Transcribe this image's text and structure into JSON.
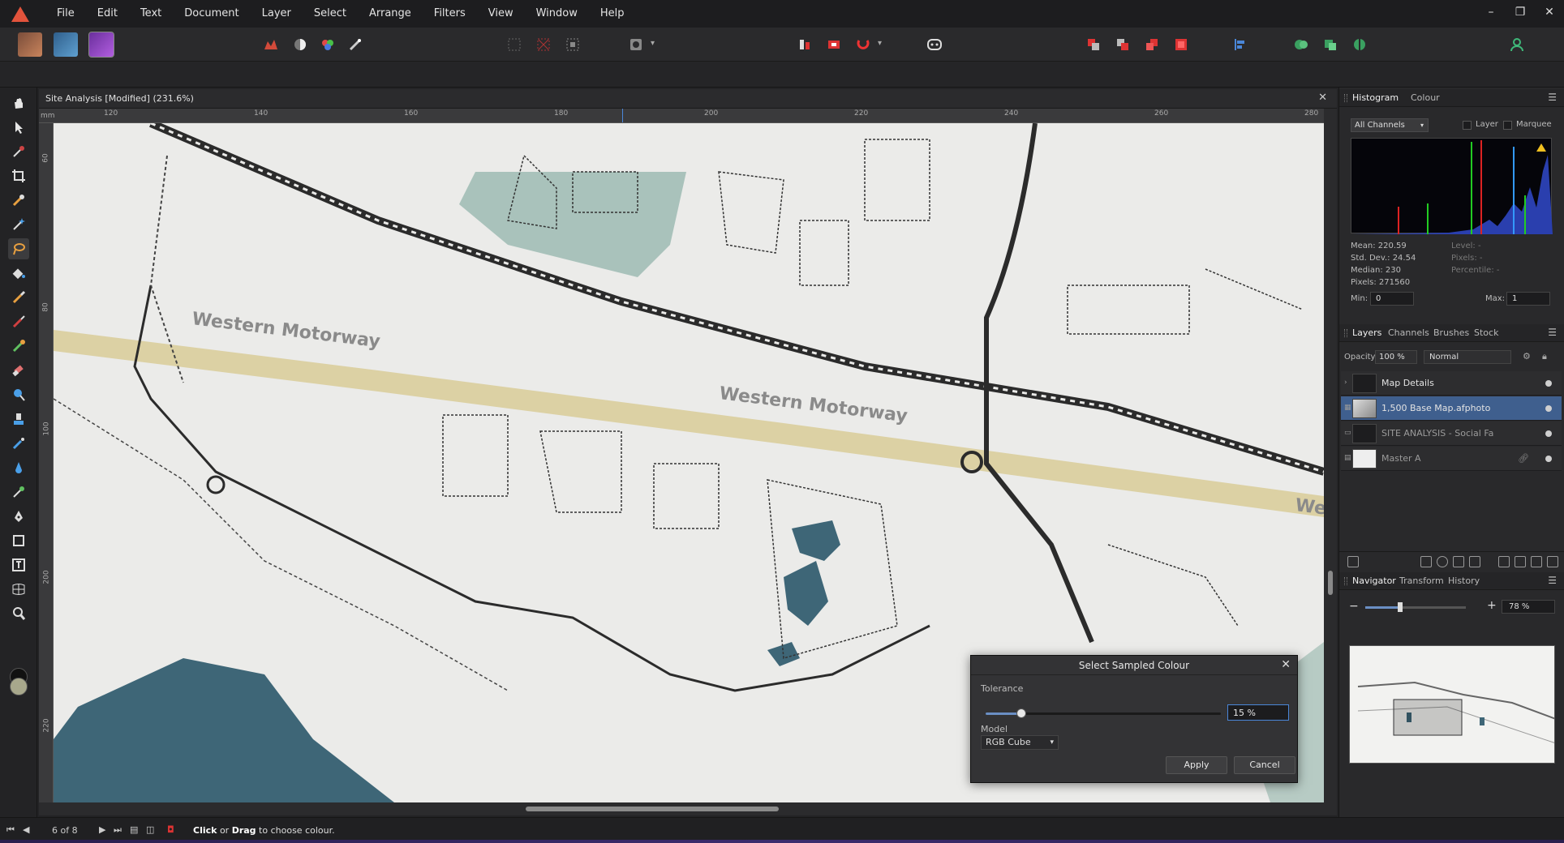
{
  "menubar": {
    "items": [
      "File",
      "Edit",
      "Text",
      "Document",
      "Layer",
      "Select",
      "Arrange",
      "Filters",
      "View",
      "Window",
      "Help"
    ],
    "window_controls": [
      "–",
      "❐",
      "✕"
    ]
  },
  "document": {
    "title": "Site Analysis [Modified] (231.6%)",
    "ruler_unit": "mm",
    "ruler_top_labels": [
      "120",
      "140",
      "160",
      "180",
      "200",
      "220",
      "240",
      "260",
      "280"
    ],
    "ruler_left_labels": [
      "60",
      "80",
      "100",
      "200",
      "220"
    ]
  },
  "map": {
    "road_label_1": "Western Motorway",
    "road_label_2": "Western Motorway",
    "road_label_3": "We",
    "colors": {
      "paper": "#ebebe9",
      "water": "#3e6677",
      "park": "#a9c2bb",
      "motorway": "#dcd1a4",
      "road": "#2b2b2b"
    }
  },
  "dialog": {
    "title": "Select Sampled Colour",
    "tolerance_label": "Tolerance",
    "tolerance_value": "15 %",
    "tolerance_fraction": 0.15,
    "model_label": "Model",
    "model_value": "RGB Cube",
    "apply_label": "Apply",
    "cancel_label": "Cancel"
  },
  "histogram_panel": {
    "tabs": [
      "Histogram",
      "Colour"
    ],
    "channel": "All Channels",
    "layer_label": "Layer",
    "marquee_label": "Marquee",
    "stats": {
      "mean": "Mean: 220.59",
      "std_dev": "Std. Dev.: 24.54",
      "median": "Median: 230",
      "pixels": "Pixels: 271560",
      "level": "Level: -",
      "pixels_sel": "Pixels: -",
      "percentile": "Percentile: -"
    },
    "min_label": "Min:",
    "min_value": "0",
    "max_label": "Max:",
    "max_value": "1"
  },
  "layers_panel": {
    "tabs": [
      "Layers",
      "Channels",
      "Brushes",
      "Stock"
    ],
    "opacity_label": "Opacity:",
    "opacity_value": "100 %",
    "blend_mode": "Normal",
    "layers": [
      {
        "name": "Map Details",
        "selected": false
      },
      {
        "name": "1,500 Base Map.afphoto",
        "selected": true
      },
      {
        "name": "SITE ANALYSIS - Social Fa",
        "selected": false
      },
      {
        "name": "Master A",
        "selected": false
      }
    ]
  },
  "navigator_panel": {
    "tabs": [
      "Navigator",
      "Transform",
      "History"
    ],
    "zoom_value": "78 %",
    "zoom_fraction": 0.35
  },
  "statusbar": {
    "page_count": "6 of 8",
    "msg_bold_1": "Click",
    "msg_mid": " or ",
    "msg_bold_2": "Drag",
    "msg_tail": " to choose colour."
  }
}
